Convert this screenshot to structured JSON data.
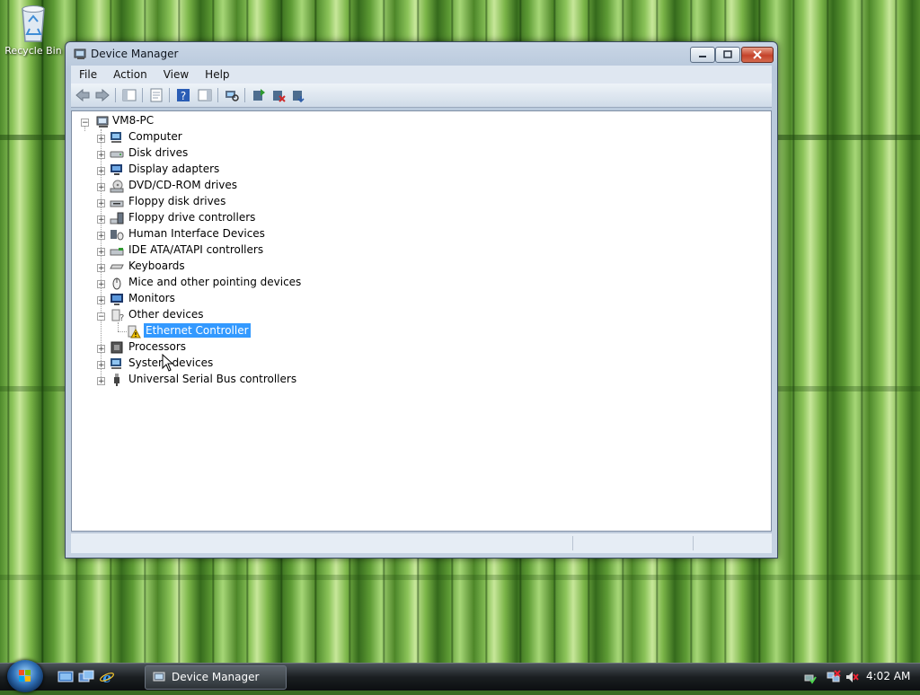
{
  "desktop": {
    "recycle_bin_label": "Recycle Bin"
  },
  "window": {
    "title": "Device Manager",
    "icon": "device-manager-icon",
    "caption_buttons": [
      "minimize",
      "maximize",
      "close"
    ]
  },
  "menubar": {
    "items": [
      {
        "label": "File"
      },
      {
        "label": "Action"
      },
      {
        "label": "View"
      },
      {
        "label": "Help"
      }
    ]
  },
  "toolbar": {
    "buttons": [
      "back-icon",
      "forward-icon",
      "show-hide-console-tree-icon",
      "properties-icon",
      "help-icon",
      "action-pane-icon",
      "scan-hardware-icon",
      "update-driver-icon",
      "uninstall-icon",
      "disable-icon"
    ]
  },
  "tree": {
    "root": {
      "label": "VM8-PC",
      "expanded": true
    },
    "items": [
      {
        "label": "Computer",
        "icon": "computer-icon",
        "expanded": false
      },
      {
        "label": "Disk drives",
        "icon": "disk-drive-icon",
        "expanded": false
      },
      {
        "label": "Display adapters",
        "icon": "display-adapter-icon",
        "expanded": false
      },
      {
        "label": "DVD/CD-ROM drives",
        "icon": "dvd-drive-icon",
        "expanded": false
      },
      {
        "label": "Floppy disk drives",
        "icon": "floppy-drive-icon",
        "expanded": false
      },
      {
        "label": "Floppy drive controllers",
        "icon": "floppy-controller-icon",
        "expanded": false
      },
      {
        "label": "Human Interface Devices",
        "icon": "hid-icon",
        "expanded": false
      },
      {
        "label": "IDE ATA/ATAPI controllers",
        "icon": "ide-controller-icon",
        "expanded": false
      },
      {
        "label": "Keyboards",
        "icon": "keyboard-icon",
        "expanded": false
      },
      {
        "label": "Mice and other pointing devices",
        "icon": "mouse-icon",
        "expanded": false
      },
      {
        "label": "Monitors",
        "icon": "monitor-icon",
        "expanded": false
      },
      {
        "label": "Other devices",
        "icon": "unknown-device-icon",
        "expanded": true,
        "children": [
          {
            "label": "Ethernet Controller",
            "icon": "warning-device-icon",
            "selected": true,
            "status": "warning"
          }
        ]
      },
      {
        "label": "Processors",
        "icon": "processor-icon",
        "expanded": false
      },
      {
        "label": "System devices",
        "icon": "system-device-icon",
        "expanded": false
      },
      {
        "label": "Universal Serial Bus controllers",
        "icon": "usb-icon",
        "expanded": false
      }
    ]
  },
  "taskbar": {
    "start_button": "windows-start-orb",
    "quick_launch": [
      "show-desktop-icon",
      "switch-windows-icon",
      "internet-explorer-icon"
    ],
    "tasks": [
      {
        "label": "Device Manager",
        "icon": "device-manager-icon"
      }
    ],
    "tray_icons": [
      "safely-remove-hardware-icon",
      "network-disconnected-icon",
      "volume-muted-icon"
    ],
    "clock": "4:02 AM"
  },
  "colors": {
    "selection": "#3399ff",
    "window_frame": "#c9d6e6",
    "taskbar": "#1b1f22"
  }
}
